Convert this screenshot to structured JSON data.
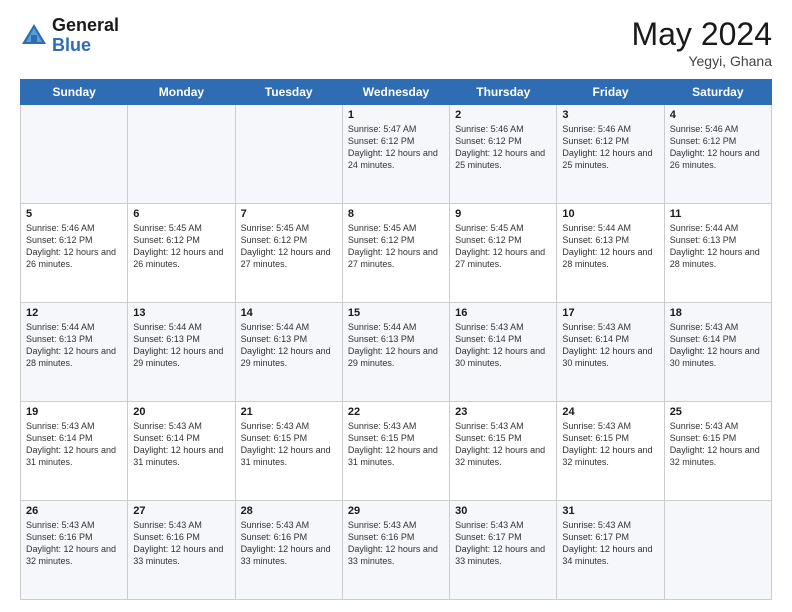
{
  "logo": {
    "general": "General",
    "blue": "Blue"
  },
  "title": {
    "month_year": "May 2024",
    "location": "Yegyi, Ghana"
  },
  "header_days": [
    "Sunday",
    "Monday",
    "Tuesday",
    "Wednesday",
    "Thursday",
    "Friday",
    "Saturday"
  ],
  "weeks": [
    [
      {
        "day": "",
        "info": ""
      },
      {
        "day": "",
        "info": ""
      },
      {
        "day": "",
        "info": ""
      },
      {
        "day": "1",
        "info": "Sunrise: 5:47 AM\nSunset: 6:12 PM\nDaylight: 12 hours and 24 minutes."
      },
      {
        "day": "2",
        "info": "Sunrise: 5:46 AM\nSunset: 6:12 PM\nDaylight: 12 hours and 25 minutes."
      },
      {
        "day": "3",
        "info": "Sunrise: 5:46 AM\nSunset: 6:12 PM\nDaylight: 12 hours and 25 minutes."
      },
      {
        "day": "4",
        "info": "Sunrise: 5:46 AM\nSunset: 6:12 PM\nDaylight: 12 hours and 26 minutes."
      }
    ],
    [
      {
        "day": "5",
        "info": "Sunrise: 5:46 AM\nSunset: 6:12 PM\nDaylight: 12 hours and 26 minutes."
      },
      {
        "day": "6",
        "info": "Sunrise: 5:45 AM\nSunset: 6:12 PM\nDaylight: 12 hours and 26 minutes."
      },
      {
        "day": "7",
        "info": "Sunrise: 5:45 AM\nSunset: 6:12 PM\nDaylight: 12 hours and 27 minutes."
      },
      {
        "day": "8",
        "info": "Sunrise: 5:45 AM\nSunset: 6:12 PM\nDaylight: 12 hours and 27 minutes."
      },
      {
        "day": "9",
        "info": "Sunrise: 5:45 AM\nSunset: 6:12 PM\nDaylight: 12 hours and 27 minutes."
      },
      {
        "day": "10",
        "info": "Sunrise: 5:44 AM\nSunset: 6:13 PM\nDaylight: 12 hours and 28 minutes."
      },
      {
        "day": "11",
        "info": "Sunrise: 5:44 AM\nSunset: 6:13 PM\nDaylight: 12 hours and 28 minutes."
      }
    ],
    [
      {
        "day": "12",
        "info": "Sunrise: 5:44 AM\nSunset: 6:13 PM\nDaylight: 12 hours and 28 minutes."
      },
      {
        "day": "13",
        "info": "Sunrise: 5:44 AM\nSunset: 6:13 PM\nDaylight: 12 hours and 29 minutes."
      },
      {
        "day": "14",
        "info": "Sunrise: 5:44 AM\nSunset: 6:13 PM\nDaylight: 12 hours and 29 minutes."
      },
      {
        "day": "15",
        "info": "Sunrise: 5:44 AM\nSunset: 6:13 PM\nDaylight: 12 hours and 29 minutes."
      },
      {
        "day": "16",
        "info": "Sunrise: 5:43 AM\nSunset: 6:14 PM\nDaylight: 12 hours and 30 minutes."
      },
      {
        "day": "17",
        "info": "Sunrise: 5:43 AM\nSunset: 6:14 PM\nDaylight: 12 hours and 30 minutes."
      },
      {
        "day": "18",
        "info": "Sunrise: 5:43 AM\nSunset: 6:14 PM\nDaylight: 12 hours and 30 minutes."
      }
    ],
    [
      {
        "day": "19",
        "info": "Sunrise: 5:43 AM\nSunset: 6:14 PM\nDaylight: 12 hours and 31 minutes."
      },
      {
        "day": "20",
        "info": "Sunrise: 5:43 AM\nSunset: 6:14 PM\nDaylight: 12 hours and 31 minutes."
      },
      {
        "day": "21",
        "info": "Sunrise: 5:43 AM\nSunset: 6:15 PM\nDaylight: 12 hours and 31 minutes."
      },
      {
        "day": "22",
        "info": "Sunrise: 5:43 AM\nSunset: 6:15 PM\nDaylight: 12 hours and 31 minutes."
      },
      {
        "day": "23",
        "info": "Sunrise: 5:43 AM\nSunset: 6:15 PM\nDaylight: 12 hours and 32 minutes."
      },
      {
        "day": "24",
        "info": "Sunrise: 5:43 AM\nSunset: 6:15 PM\nDaylight: 12 hours and 32 minutes."
      },
      {
        "day": "25",
        "info": "Sunrise: 5:43 AM\nSunset: 6:15 PM\nDaylight: 12 hours and 32 minutes."
      }
    ],
    [
      {
        "day": "26",
        "info": "Sunrise: 5:43 AM\nSunset: 6:16 PM\nDaylight: 12 hours and 32 minutes."
      },
      {
        "day": "27",
        "info": "Sunrise: 5:43 AM\nSunset: 6:16 PM\nDaylight: 12 hours and 33 minutes."
      },
      {
        "day": "28",
        "info": "Sunrise: 5:43 AM\nSunset: 6:16 PM\nDaylight: 12 hours and 33 minutes."
      },
      {
        "day": "29",
        "info": "Sunrise: 5:43 AM\nSunset: 6:16 PM\nDaylight: 12 hours and 33 minutes."
      },
      {
        "day": "30",
        "info": "Sunrise: 5:43 AM\nSunset: 6:17 PM\nDaylight: 12 hours and 33 minutes."
      },
      {
        "day": "31",
        "info": "Sunrise: 5:43 AM\nSunset: 6:17 PM\nDaylight: 12 hours and 34 minutes."
      },
      {
        "day": "",
        "info": ""
      }
    ]
  ]
}
